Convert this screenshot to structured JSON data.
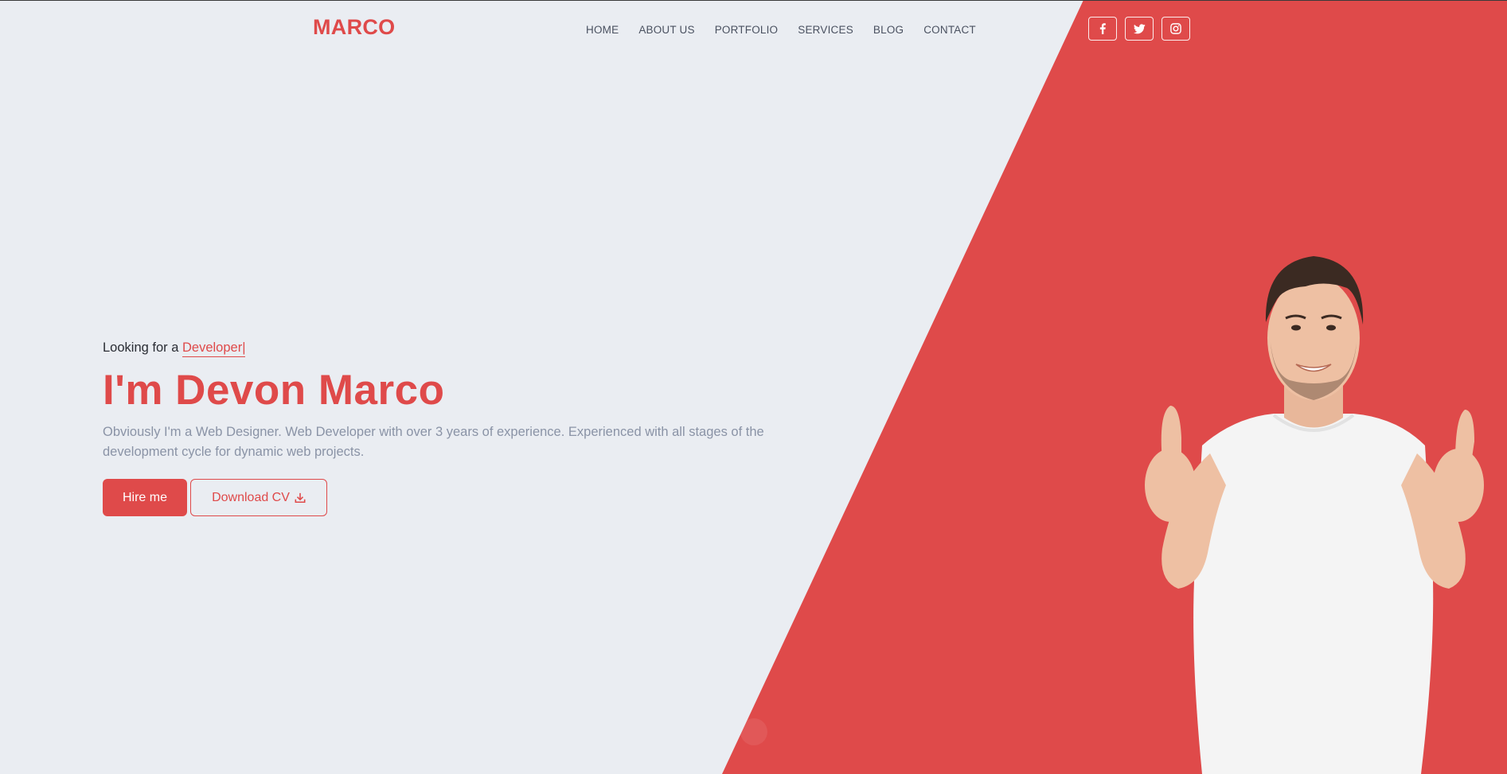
{
  "brand": {
    "name": "MARCO"
  },
  "nav": {
    "items": [
      "HOME",
      "ABOUT US",
      "PORTFOLIO",
      "SERVICES",
      "BLOG",
      "CONTACT"
    ]
  },
  "social": {
    "icons": [
      "facebook-icon",
      "twitter-icon",
      "instagram-icon"
    ]
  },
  "hero": {
    "looking_prefix": "Looking for a ",
    "role": "Developer|",
    "title": "I'm Devon Marco",
    "description": "Obviously I'm a Web Designer. Web Developer with over 3 years of experience. Experienced with all stages of the development cycle for dynamic web projects.",
    "hire_label": "Hire me",
    "download_label": "Download CV",
    "download_icon": "download-icon"
  },
  "colors": {
    "accent": "#df4a4a",
    "background": "#eaedf2",
    "text_muted": "#8a93a6"
  }
}
